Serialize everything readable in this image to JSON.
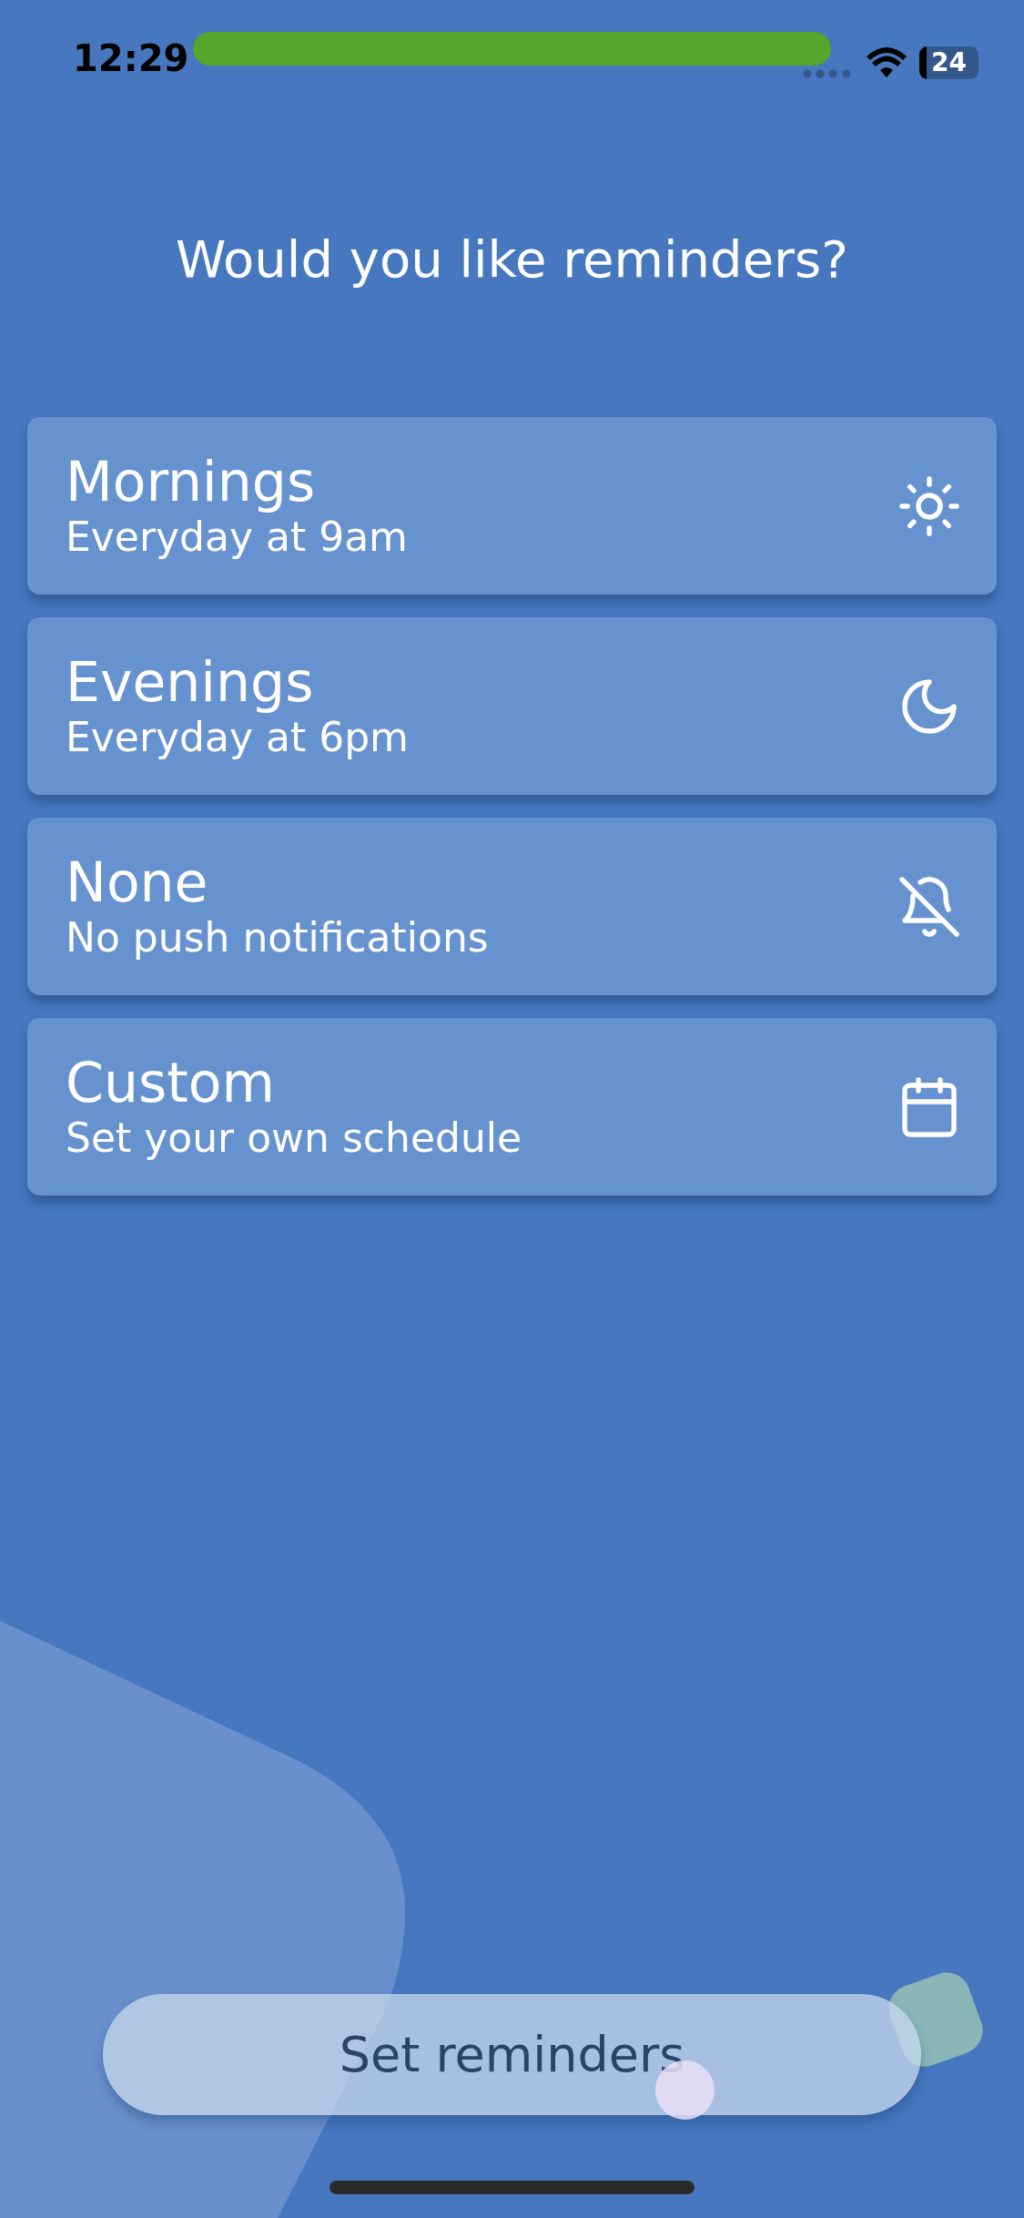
{
  "status_bar": {
    "time": "12:29",
    "battery": "24"
  },
  "title": "Would you like reminders?",
  "options": [
    {
      "title": "Mornings",
      "subtitle": "Everyday at 9am",
      "kind": "sun"
    },
    {
      "title": "Evenings",
      "subtitle": "Everyday at 6pm",
      "kind": "moon"
    },
    {
      "title": "None",
      "subtitle": "No push notifications",
      "kind": "bell-off"
    },
    {
      "title": "Custom",
      "subtitle": "Set your own schedule",
      "kind": "calendar"
    }
  ],
  "button": "Set reminders"
}
